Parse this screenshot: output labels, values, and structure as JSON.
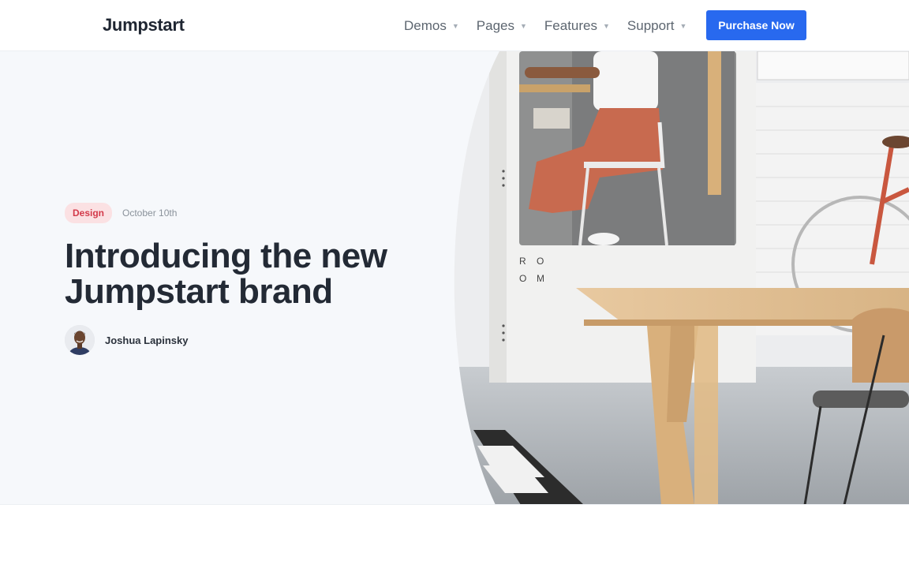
{
  "header": {
    "logo": "Jumpstart",
    "nav": [
      {
        "label": "Demos"
      },
      {
        "label": "Pages"
      },
      {
        "label": "Features"
      },
      {
        "label": "Support"
      }
    ],
    "cta_label": "Purchase Now"
  },
  "hero": {
    "badge": "Design",
    "date": "October 10th",
    "title_line1": "Introducing the new",
    "title_line2": "Jumpstart brand",
    "author": "Joshua Lapinsky",
    "room_text": [
      "R",
      "O",
      "O",
      "M"
    ]
  },
  "colors": {
    "accent": "#2869ef",
    "badge_bg": "#fbe1e3",
    "badge_text": "#d33a4a",
    "hero_bg": "#f6f8fb"
  }
}
